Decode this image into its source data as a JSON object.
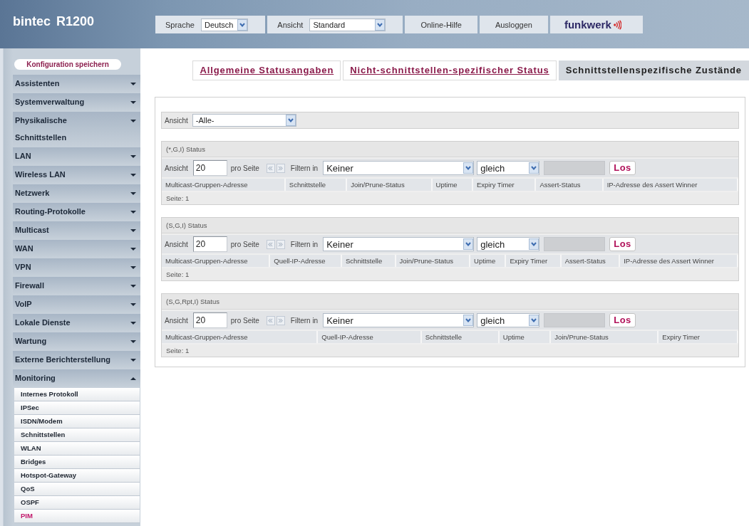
{
  "header": {
    "product": "bintec R1200",
    "toolbar": [
      {
        "kind": "select",
        "label": "Sprache",
        "value": "Deutsch"
      },
      {
        "kind": "select",
        "label": "Ansicht",
        "value": "Standard"
      },
      {
        "kind": "button",
        "label": "Online-Hilfe"
      },
      {
        "kind": "button",
        "label": "Ausloggen"
      }
    ],
    "logo": "funkwerk"
  },
  "sidebar": {
    "save_button": "Konfiguration speichern",
    "items": [
      {
        "label": "Assistenten",
        "expanded": false
      },
      {
        "label": "Systemverwaltung",
        "expanded": false
      },
      {
        "label": "Physikalische Schnittstellen",
        "expanded": false
      },
      {
        "label": "LAN",
        "expanded": false
      },
      {
        "label": "Wireless LAN",
        "expanded": false
      },
      {
        "label": "Netzwerk",
        "expanded": false
      },
      {
        "label": "Routing-Protokolle",
        "expanded": false
      },
      {
        "label": "Multicast",
        "expanded": false
      },
      {
        "label": "WAN",
        "expanded": false
      },
      {
        "label": "VPN",
        "expanded": false
      },
      {
        "label": "Firewall",
        "expanded": false
      },
      {
        "label": "VoIP",
        "expanded": false
      },
      {
        "label": "Lokale Dienste",
        "expanded": false
      },
      {
        "label": "Wartung",
        "expanded": false
      },
      {
        "label": "Externe Berichterstellung",
        "expanded": false
      },
      {
        "label": "Monitoring",
        "expanded": true,
        "children": [
          {
            "label": "Internes Protokoll",
            "selected": false
          },
          {
            "label": "IPSec",
            "selected": false
          },
          {
            "label": "ISDN/Modem",
            "selected": false
          },
          {
            "label": "Schnittstellen",
            "selected": false
          },
          {
            "label": "WLAN",
            "selected": false
          },
          {
            "label": "Bridges",
            "selected": false
          },
          {
            "label": "Hotspot-Gateway",
            "selected": false
          },
          {
            "label": "QoS",
            "selected": false
          },
          {
            "label": "OSPF",
            "selected": false
          },
          {
            "label": "PIM",
            "selected": true
          }
        ]
      }
    ]
  },
  "tabs": [
    {
      "label": "Allgemeine Statusangaben",
      "selected": false
    },
    {
      "label": "Nicht-schnittstellen-spezifischer Status",
      "selected": false
    },
    {
      "label": "Schnittstellenspezifische Zustände",
      "selected": true
    }
  ],
  "view": {
    "label": "Ansicht",
    "value": "-Alle-"
  },
  "sections": [
    {
      "title": "(*,G,I) Status",
      "view_label": "Ansicht",
      "per_page": "20",
      "per_page_label": "pro Seite",
      "pager": [
        {
          "kind": "back",
          "disabled": true
        },
        {
          "kind": "forward",
          "disabled": true
        }
      ],
      "filter_label": "Filtern in",
      "filter_field": "Keiner",
      "operator": "gleich",
      "value_field": {
        "disabled": true
      },
      "go_button": "Los",
      "columns": [
        "Multicast-Gruppen-Adresse",
        "Schnittstelle",
        "Join/Prune-Status",
        "Uptime",
        "Expiry Timer",
        "Assert-Status",
        "IP-Adresse des Assert Winner"
      ],
      "page": "Seite: 1"
    },
    {
      "title": "(S,G,I) Status",
      "view_label": "Ansicht",
      "per_page": "20",
      "per_page_label": "pro Seite",
      "pager": [
        {
          "kind": "back",
          "disabled": true
        },
        {
          "kind": "forward",
          "disabled": true
        }
      ],
      "filter_label": "Filtern in",
      "filter_field": "Keiner",
      "operator": "gleich",
      "value_field": {
        "disabled": true
      },
      "go_button": "Los",
      "columns": [
        "Multicast-Gruppen-Adresse",
        "Quell-IP-Adresse",
        "Schnittstelle",
        "Join/Prune-Status",
        "Uptime",
        "Expiry Timer",
        "Assert-Status",
        "IP-Adresse des Assert Winner"
      ],
      "page": "Seite: 1"
    },
    {
      "title": "(S,G,Rpt,I) Status",
      "view_label": "Ansicht",
      "per_page": "20",
      "per_page_label": "pro Seite",
      "pager": [
        {
          "kind": "back",
          "disabled": true
        },
        {
          "kind": "forward",
          "disabled": true
        }
      ],
      "filter_label": "Filtern in",
      "filter_field": "Keiner",
      "operator": "gleich",
      "value_field": {
        "disabled": true
      },
      "go_button": "Los",
      "columns": [
        "Multicast-Gruppen-Adresse",
        "Quell-IP-Adresse",
        "Schnittstelle",
        "Uptime",
        "Join/Prune-Status",
        "Expiry Timer"
      ],
      "page": "Seite: 1"
    }
  ]
}
